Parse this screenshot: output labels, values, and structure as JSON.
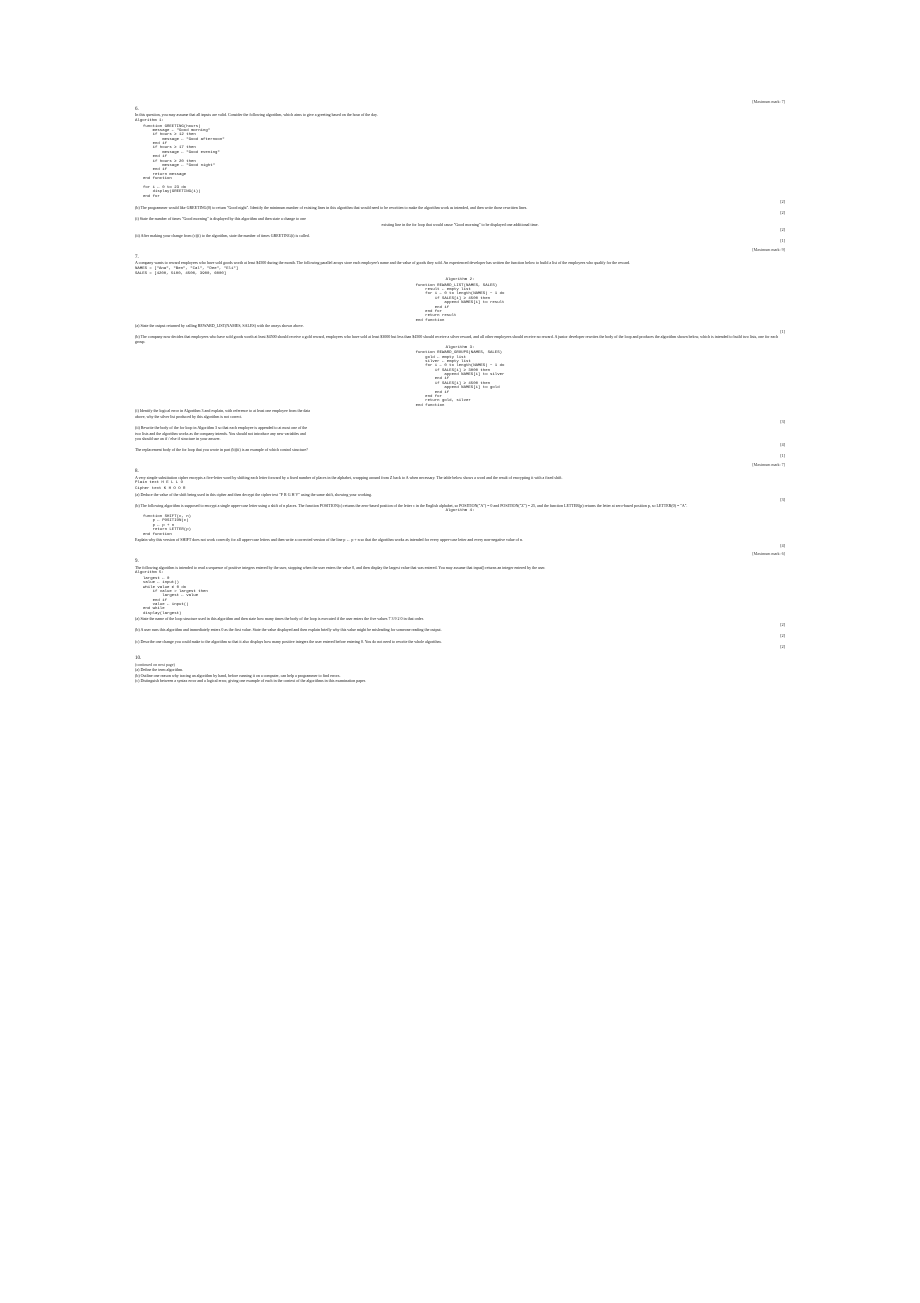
{
  "q6": {
    "num": "6.",
    "header_right": "[Maximum mark: 7]",
    "intro": "In this question, you may assume that all inputs are valid. Consider the following algorithm, which aims to give a greeting based on the hour of the day.",
    "preface": "Algorithm 1:",
    "code": "function GREETING(hours)\n    message ← \"Good morning\"\n    if hours ≥ 12 then\n        message ← \"Good afternoon\"\n    end if\n    if hours ≥ 17 then\n        message ← \"Good evening\"\n    end if\n    if hours ≥ 20 then\n        message ← \"Good night\"\n    end if\n    return message\nend function\n\nfor i ← 0 to 23 do\n    display(GREETING(i))\nend for",
    "part_a_right": "[2]",
    "part_b": "(b)   The programmer would like GREETING(0) to return \"Good night\". Identify the minimum number of existing lines in this algorithm that would need to be rewritten to make the algorithm work as intended, and then write those rewritten lines.",
    "part_b_right": "[2]",
    "part_i_line1": "(i)   State the number of times \"Good morning\" is displayed by this algorithm and then state a change to one",
    "part_i_line2_center": "existing line in the for loop that would cause \"Good morning\" to be displayed one additional time.",
    "part_c_i_right": "[2]",
    "part_c_ii": "(ii)  After making your change from (c)(i) to the algorithm, state the number of times GREETING(i) is called.",
    "part_c_ii_right": "[1]"
  },
  "q7": {
    "num": "7.",
    "header_right": "[Maximum mark: 9]",
    "intro": "A company wants to reward employees who have sold goods worth at least $4500 during the month. The following parallel arrays store each employee's name and the value of goods they sold. An experienced developer has written the function below to build a list of the employees who qualify for the reward.",
    "names_line": "NAMES = [\"Ana\", \"Ben\", \"Cal\", \"Dee\", \"Eli\"]",
    "sales_line": "SALES = [4200, 5100, 4500, 3900, 6000]",
    "algo_title_center": "Algorithm 2:",
    "code_center": "function REWARD_LIST(NAMES, SALES)\n    result ← empty list\n    for i ← 0 to length(NAMES) − 1 do\n        if SALES[i] ≥ 4500 then\n            append NAMES[i] to result\n        end if\n    end for\n    return result\nend function",
    "part_a_line": "(a)   State the output returned by calling REWARD_LIST(NAMES, SALES) with the arrays shown above.",
    "part_a_right": "[1]",
    "part_b_intro": "(b)   The company now decides that employees who have sold goods worth at least $4500 should receive a gold reward, employees who have sold at least $3000 but less than $4500 should receive a silver reward, and all other employees should receive no reward. A junior developer rewrites the body of the loop and produces the algorithm shown below, which is intended to build two lists, one for each group.",
    "algo3_center": "Algorithm 3:",
    "code3_center": "function REWARD_GROUPS(NAMES, SALES)\n    gold ← empty list\n    silver ← empty list\n    for i ← 0 to length(NAMES) − 1 do\n        if SALES[i] ≥ 3000 then\n            append NAMES[i] to silver\n        end if\n        if SALES[i] ≥ 4500 then\n            append NAMES[i] to gold\n        end if\n    end for\n    return gold, silver\nend function",
    "part_b_i": "(i)   Identify the logical error in Algorithm 3 and explain, with reference to at least one employee from the data",
    "part_b_i_line2": "above, why the silver list produced by this algorithm is not correct.",
    "part_b_i_right": "[3]",
    "part_b_ii_l1": "(ii)  Rewrite the body of the for loop in Algorithm 3 so that each employee is appended to at most one of the",
    "part_b_ii_l2": "two lists and the algorithm works as the company intends. You should not introduce any new variables and",
    "part_b_ii_l3": "you should use an if / else if structure in your answer.",
    "part_b_ii_right": "[4]",
    "part_c": "The replacement body of the for loop that you wrote in part (b)(ii) is an example of which control structure?",
    "part_c_right": "[1]"
  },
  "q8": {
    "num": "8.",
    "header_right": "[Maximum mark: 7]",
    "intro": "A very simple substitution cipher encrypts a five-letter word by shifting each letter forward by a fixed number of places in the alphabet, wrapping around from Z back to A when necessary. The table below shows a word and the result of encrypting it with a fixed shift.",
    "table_line1": "Plain text    H  E  L  L  O",
    "table_line2": "Cipher text   K  H  O  O  R",
    "part_a": "(a)   Deduce the value of the shift being used in this cipher and then decrypt the cipher text \"F  R  G  H  V\" using the same shift, showing your working.",
    "part_a_right": "[3]",
    "part_b_intro": "(b)   The following algorithm is supposed to encrypt a single upper-case letter using a shift of n places. The function POSITION(c) returns the zero-based position of the letter c in the English alphabet, so POSITION(\"A\") = 0 and POSITION(\"Z\") = 25, and the function LETTER(p) returns the letter at zero-based position p, so LETTER(0) = \"A\".",
    "algo4_center": "Algorithm 4:",
    "code": "function SHIFT(c, n)\n    p ← POSITION(c)\n    p ← p + n\n    return LETTER(p)\nend function",
    "part_b_q": "Explain why this version of SHIFT does not work correctly for all upper-case letters and then write a corrected version of the line   p ← p + n   so that the algorithm works as intended for every upper-case letter and every non-negative value of n.",
    "part_b_right": "[4]"
  },
  "q9": {
    "num": "9.",
    "header_right": "[Maximum mark: 6]",
    "intro": "The following algorithm is intended to read a sequence of positive integers entered by the user, stopping when the user enters the value 0, and then display the largest value that was entered. You may assume that input() returns an integer entered by the user.",
    "algo5": "Algorithm 5:",
    "code": "largest ← 0\nvalue ← input()\nwhile value ≠ 0 do\n    if value > largest then\n        largest ← value\n    end if\n    value ← input()\nend while\ndisplay(largest)",
    "part_a": "(a)   State the name of the loop structure used in this algorithm and then state how many times the body of the loop is executed if the user enters the five values   7   3   9   2   0   in that order.",
    "part_a_right": "[2]",
    "part_b": "(b)   A user runs this algorithm and immediately enters 0 as the first value. State the value displayed and then explain briefly why this value might be misleading for someone reading the output.",
    "part_b_right": "[2]",
    "part_c": "(c)   Describe one change you could make to the algorithm so that it also displays how many positive integers the user entered before entering 0. You do not need to rewrite the whole algorithm.",
    "part_c_right": "[2]"
  },
  "q10": {
    "num": "10.",
    "intro": "(continued on next page)",
    "part_a": "(a)   Define the term algorithm.",
    "part_b": "(b)   Outline one reason why tracing an algorithm by hand, before running it on a computer, can help a programmer to find errors.",
    "part_c": "(c)   Distinguish between a syntax error and a logical error, giving one example of each in the context of the algorithms in this examination paper."
  }
}
